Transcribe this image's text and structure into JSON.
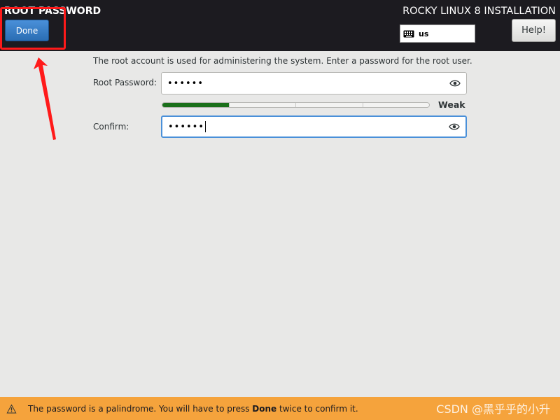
{
  "header": {
    "spoke_title": "ROOT PASSWORD",
    "done_label": "Done",
    "product_title": "ROCKY LINUX 8 INSTALLATION",
    "keyboard_layout": "us",
    "help_label": "Help!"
  },
  "form": {
    "intro": "The root account is used for administering the system.  Enter a password for the root user.",
    "root_password_label": "Root Password:",
    "root_password_value": "••••••",
    "strength_label": "Weak",
    "strength_level": 0.25,
    "confirm_label": "Confirm:",
    "confirm_value": "••••••"
  },
  "warning": {
    "text_before": "The password is a palindrome. You will have to press ",
    "text_bold": "Done",
    "text_after": " twice to confirm it."
  },
  "watermark": "CSDN @黑乎乎的小升",
  "colors": {
    "header_bg": "#1c1b20",
    "accent": "#4a90d9",
    "warning_bg": "#f5a33c",
    "strength_fill": "#1a6f1a",
    "annotation": "#ff1a1a"
  },
  "icons": [
    "keyboard-icon",
    "eye-icon",
    "warning-icon"
  ]
}
